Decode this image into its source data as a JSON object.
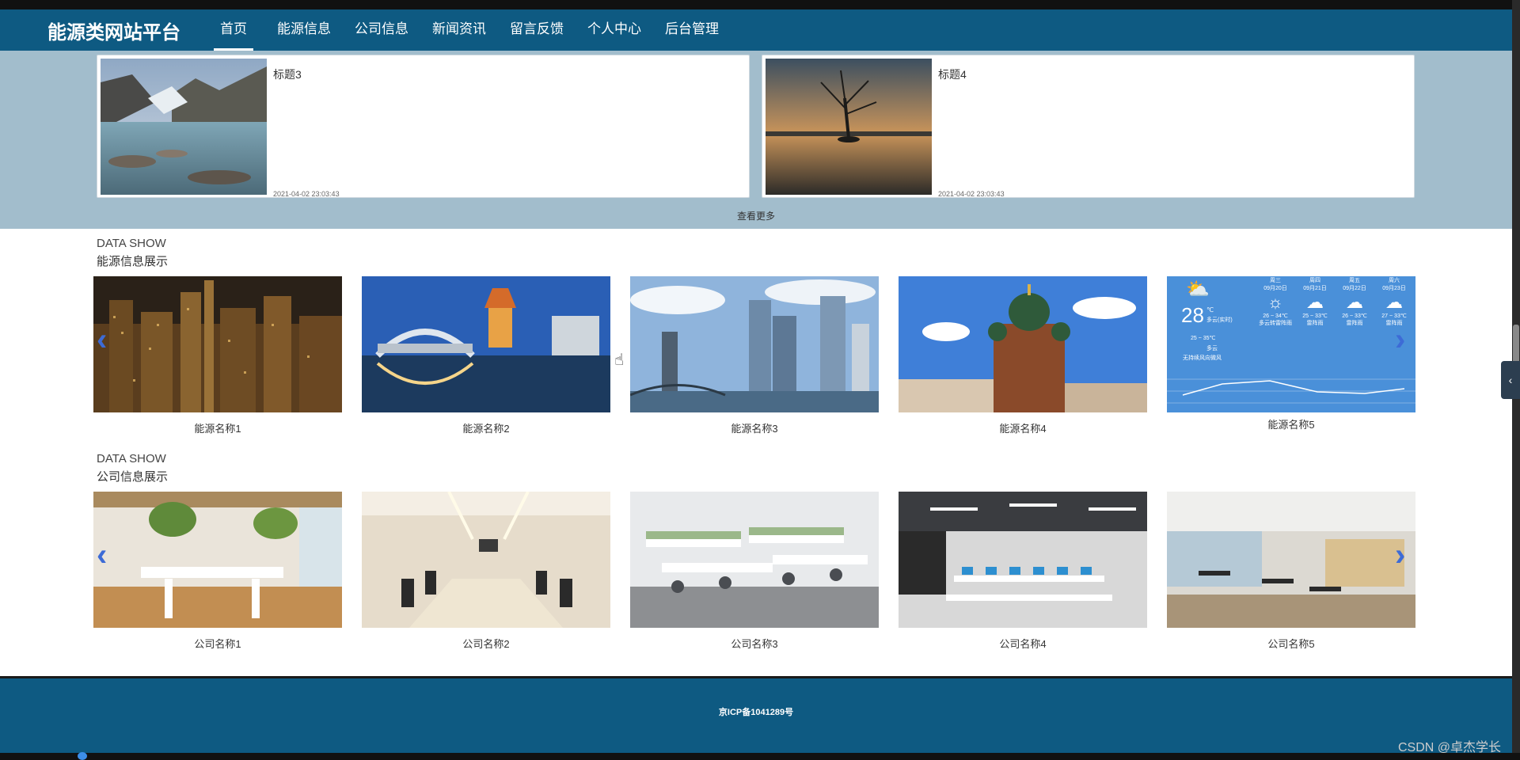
{
  "header": {
    "brand": "能源类网站平台",
    "nav": [
      "首页",
      "能源信息",
      "公司信息",
      "新闻资讯",
      "留言反馈",
      "个人中心",
      "后台管理"
    ]
  },
  "news": {
    "items": [
      {
        "title": "标题3",
        "date": "2021-04-02 23:03:43"
      },
      {
        "title": "标题4",
        "date": "2021-04-02 23:03:43"
      }
    ],
    "more": "查看更多"
  },
  "energy_section": {
    "en": "DATA SHOW",
    "cn": "能源信息展示",
    "items": [
      "能源名称1",
      "能源名称2",
      "能源名称3",
      "能源名称4",
      "能源名称5"
    ],
    "weather": {
      "temp": "28",
      "unit": "℃",
      "now": "多云(实时)",
      "range": "25 ~ 35℃",
      "cond": "多云",
      "wind": "无持续风向微风",
      "days": [
        {
          "day": "周三",
          "date": "09月20日",
          "range": "26 ~ 34℃",
          "cond": "多云转雷阵雨"
        },
        {
          "day": "周四",
          "date": "09月21日",
          "range": "25 ~ 33℃",
          "cond": "雷阵雨"
        },
        {
          "day": "周五",
          "date": "09月22日",
          "range": "26 ~ 33℃",
          "cond": "雷阵雨"
        },
        {
          "day": "周六",
          "date": "09月23日",
          "range": "27 ~ 33℃",
          "cond": "雷阵雨"
        }
      ]
    }
  },
  "company_section": {
    "en": "DATA SHOW",
    "cn": "公司信息展示",
    "items": [
      "公司名称1",
      "公司名称2",
      "公司名称3",
      "公司名称4",
      "公司名称5"
    ]
  },
  "footer": {
    "icp": "京ICP备1041289号"
  },
  "watermark": "CSDN @卓杰学长",
  "colors": {
    "nav_bg": "#0e5a82",
    "news_band": "#a2bdcc",
    "arrow": "#3d6bd6"
  },
  "icons": {
    "prev": "chevron-left-icon",
    "next": "chevron-right-icon",
    "side": "chevron-left-icon"
  }
}
